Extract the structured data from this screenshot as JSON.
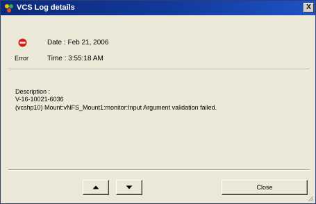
{
  "window": {
    "title": "VCS Log details",
    "close_glyph": "X",
    "app_icon": "vcs-app-icon"
  },
  "details": {
    "status_icon": "error-icon",
    "status_label": "Error",
    "date": "Date : Feb 21, 2006",
    "time": "Time : 3:55:18 AM",
    "description_label": "Description :",
    "error_code": "V-16-10021-6036",
    "message": "(vcshp10) Mount:vNFS_Mount1:monitor:Input Argument validation failed."
  },
  "buttons": {
    "up_icon": "triangle-up-icon",
    "down_icon": "triangle-down-icon",
    "close_label": "Close"
  },
  "colors": {
    "titlebar": "#123a9c",
    "error_red": "#d9201a",
    "dialog_bg": "#ece9d8"
  }
}
